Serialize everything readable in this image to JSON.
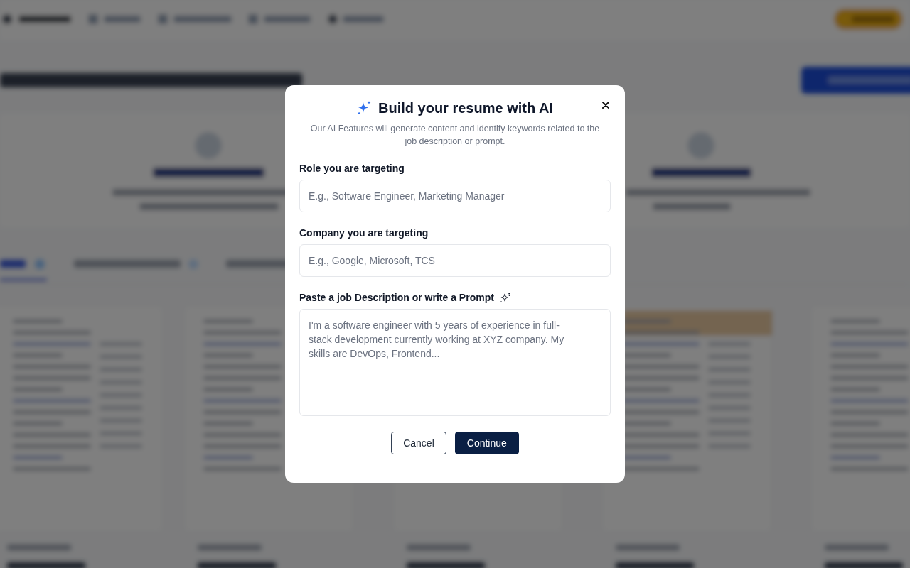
{
  "dialog": {
    "title": "Build your resume with AI",
    "subtitle": "Our AI Features will generate content and identify keywords related to the job description or prompt.",
    "fields": [
      {
        "kind": "input",
        "label": "Role you are targeting",
        "placeholder": "E.g., Software Engineer, Marketing Manager"
      },
      {
        "kind": "input",
        "label": "Company you are targeting",
        "placeholder": "E.g., Google, Microsoft, TCS"
      },
      {
        "kind": "textarea",
        "label": "Paste a job Description or write a Prompt",
        "placeholder": "I'm a software engineer with 5 years of experience in full-stack development currently working at XYZ company. My skills are DevOps, Frontend..."
      }
    ],
    "buttons": [
      {
        "kind": "cancel",
        "label": "Cancel"
      },
      {
        "kind": "confirm",
        "label": "Continue"
      }
    ]
  }
}
